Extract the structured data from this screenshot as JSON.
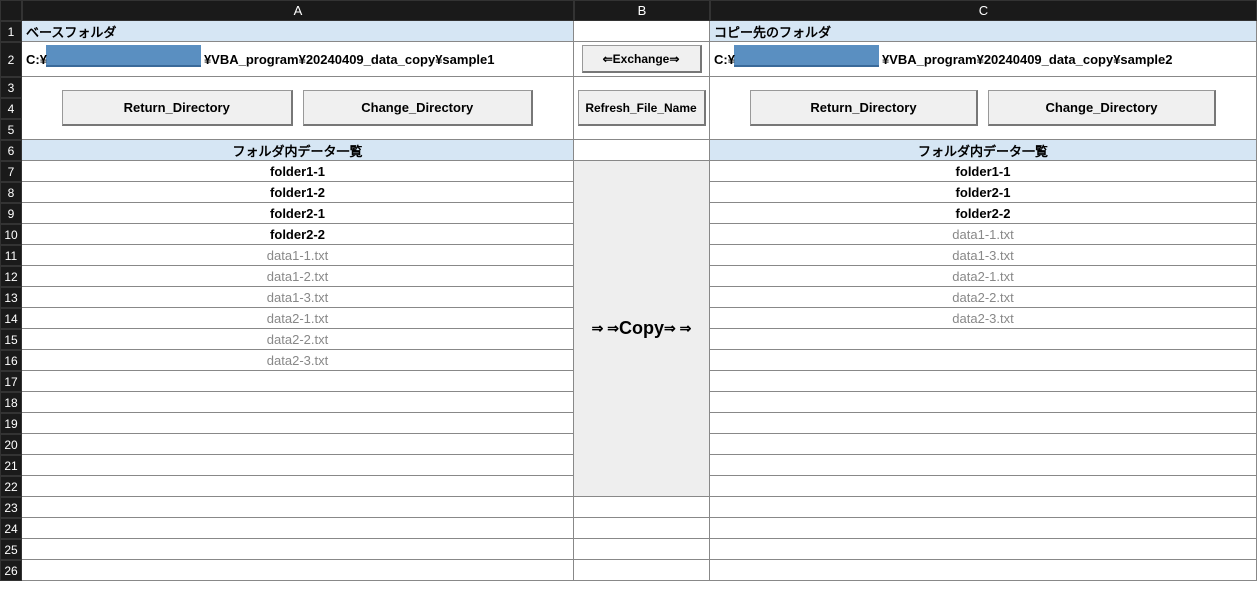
{
  "colheads": {
    "A": "A",
    "B": "B",
    "C": "C"
  },
  "rows": [
    "1",
    "2",
    "3",
    "4",
    "5",
    "6",
    "7",
    "8",
    "9",
    "10",
    "11",
    "12",
    "13",
    "14",
    "15",
    "16",
    "17",
    "18",
    "19",
    "20",
    "21",
    "22",
    "23",
    "24",
    "25",
    "26"
  ],
  "left": {
    "title": "ベースフォルダ",
    "path_prefix": "C:¥",
    "path_suffix": "¥VBA_program¥20240409_data_copy¥sample1",
    "list_header": "フォルダ内データ一覧",
    "folders": [
      "folder1-1",
      "folder1-2",
      "folder2-1",
      "folder2-2"
    ],
    "files": [
      "data1-1.txt",
      "data1-2.txt",
      "data1-3.txt",
      "data2-1.txt",
      "data2-2.txt",
      "data2-3.txt"
    ]
  },
  "right": {
    "title": "コピー先のフォルダ",
    "path_prefix": "C:¥",
    "path_suffix": "¥VBA_program¥20240409_data_copy¥sample2",
    "list_header": "フォルダ内データ一覧",
    "folders": [
      "folder1-1",
      "folder2-1",
      "folder2-2"
    ],
    "files": [
      "data1-1.txt",
      "data1-3.txt",
      "data2-1.txt",
      "data2-2.txt",
      "data2-3.txt"
    ]
  },
  "buttons": {
    "return_dir": "Return_Directory",
    "change_dir": "Change_Directory",
    "exchange": "⇐Exchange⇒",
    "refresh": "Refresh_File_Name",
    "copy": "⇒ ⇒Copy⇒ ⇒",
    "copy_big": "Copy"
  }
}
